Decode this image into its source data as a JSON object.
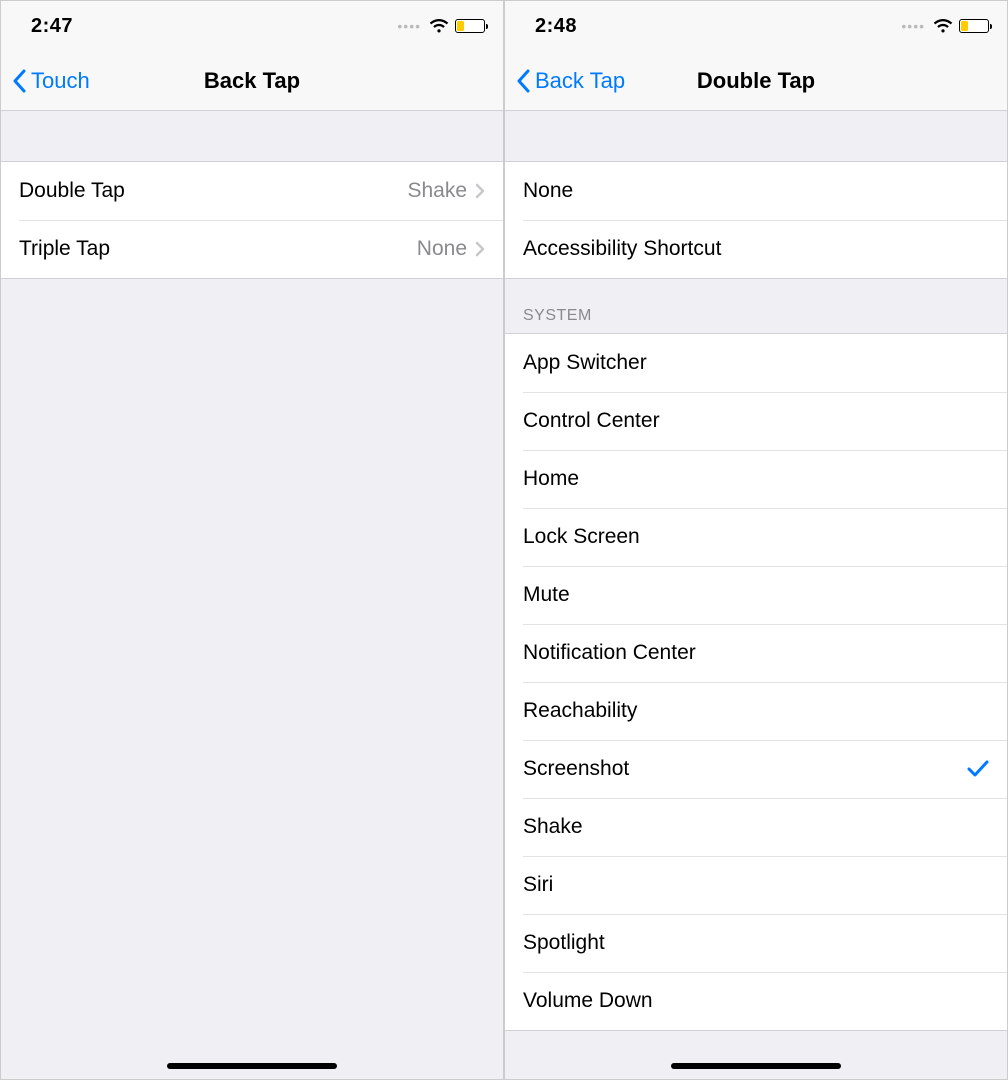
{
  "left": {
    "status_time": "2:47",
    "nav_back": "Touch",
    "nav_title": "Back Tap",
    "rows": [
      {
        "label": "Double Tap",
        "value": "Shake"
      },
      {
        "label": "Triple Tap",
        "value": "None"
      }
    ]
  },
  "right": {
    "status_time": "2:48",
    "nav_back": "Back Tap",
    "nav_title": "Double Tap",
    "top_rows": [
      {
        "label": "None",
        "checked": false
      },
      {
        "label": "Accessibility Shortcut",
        "checked": false
      }
    ],
    "system_header": "SYSTEM",
    "system_rows": [
      {
        "label": "App Switcher",
        "checked": false
      },
      {
        "label": "Control Center",
        "checked": false
      },
      {
        "label": "Home",
        "checked": false
      },
      {
        "label": "Lock Screen",
        "checked": false
      },
      {
        "label": "Mute",
        "checked": false
      },
      {
        "label": "Notification Center",
        "checked": false
      },
      {
        "label": "Reachability",
        "checked": false
      },
      {
        "label": "Screenshot",
        "checked": true
      },
      {
        "label": "Shake",
        "checked": false
      },
      {
        "label": "Siri",
        "checked": false
      },
      {
        "label": "Spotlight",
        "checked": false
      },
      {
        "label": "Volume Down",
        "checked": false
      }
    ]
  }
}
